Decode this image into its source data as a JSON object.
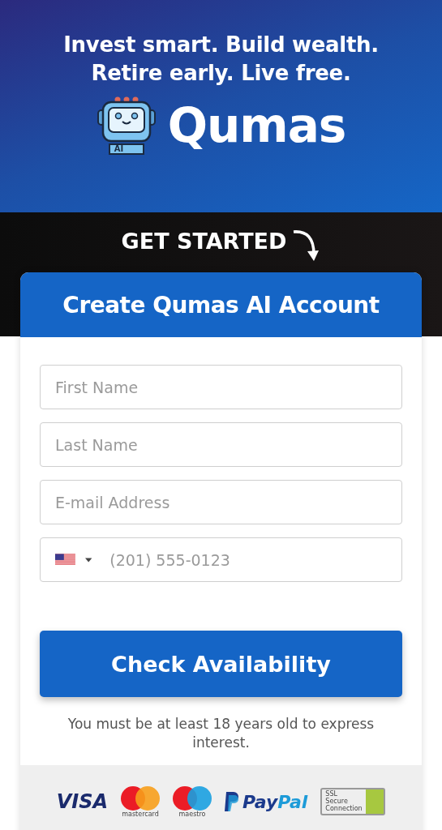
{
  "hero": {
    "headline_lines": [
      "Invest smart. Build wealth.",
      "Retire early. Live free."
    ],
    "brand": "Qumas",
    "robot_badge": "AI"
  },
  "cta_band": {
    "label": "GET STARTED"
  },
  "form": {
    "title": "Create Qumas AI Account",
    "fields": [
      {
        "kind": "text",
        "placeholder": "First Name"
      },
      {
        "kind": "text",
        "placeholder": "Last Name"
      },
      {
        "kind": "text",
        "placeholder": "E-mail Address"
      },
      {
        "kind": "phone",
        "placeholder": "(201) 555-0123"
      }
    ],
    "submit": "Check Availability",
    "note": "You must be at least 18 years old to express interest."
  },
  "payments": {
    "visa": "VISA",
    "mastercard": "mastercard",
    "maestro": "maestro",
    "paypal_a": "Pay",
    "paypal_b": "Pal",
    "ssl_lines": [
      "SSL",
      "Secure",
      "Connection"
    ]
  }
}
